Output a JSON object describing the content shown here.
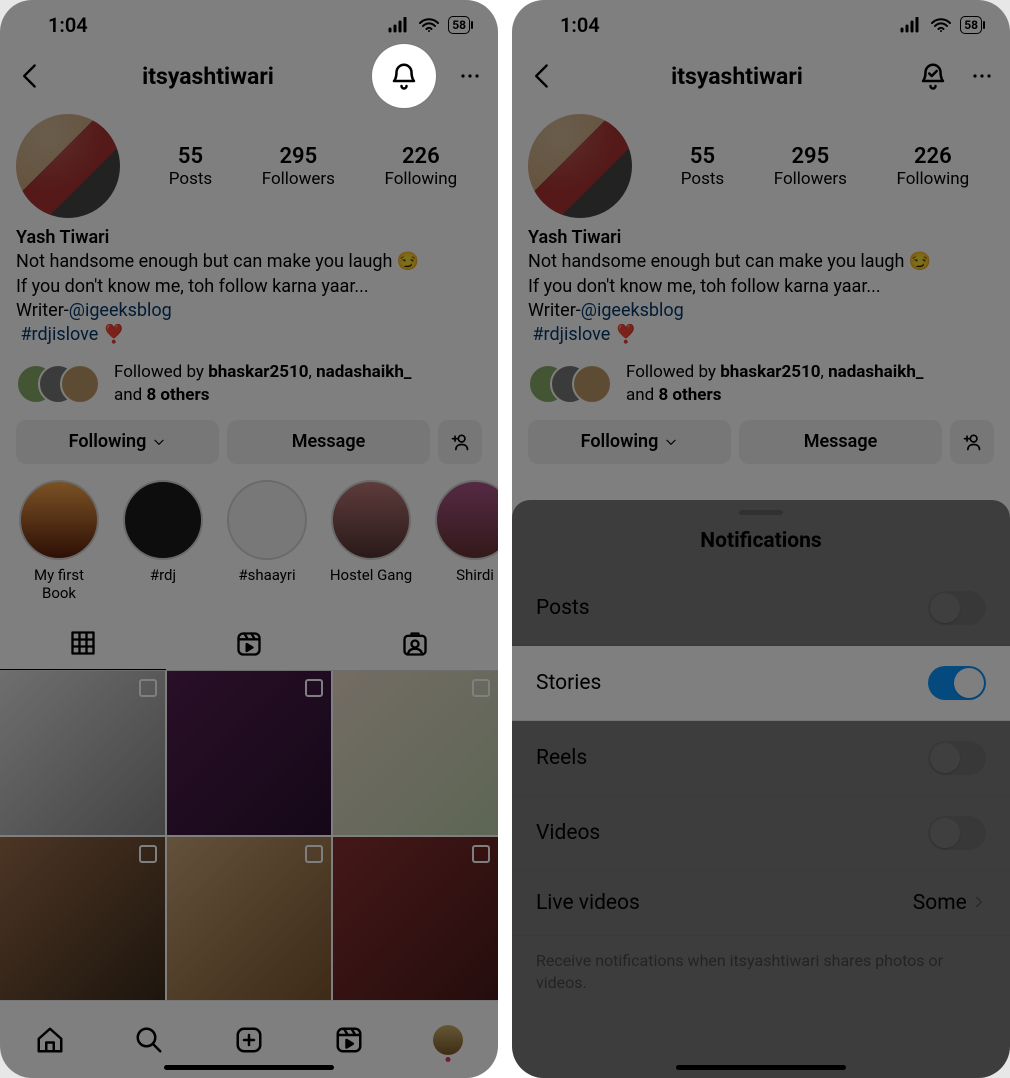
{
  "status": {
    "time": "1:04",
    "battery": "58"
  },
  "header": {
    "username": "itsyashtiwari"
  },
  "profile": {
    "name": "Yash Tiwari",
    "bio_line1": "Not handsome enough but can make you laugh 😏",
    "bio_line2": "If you don't know me, toh follow karna yaar...",
    "bio_writer_prefix": "Writer-",
    "bio_writer_handle": "@igeeksblog",
    "hashtag": "#rdjislove",
    "heart": "❣️",
    "stats": {
      "posts": {
        "num": "55",
        "label": "Posts"
      },
      "followers": {
        "num": "295",
        "label": "Followers"
      },
      "following": {
        "num": "226",
        "label": "Following"
      }
    }
  },
  "followed_by": {
    "prefix": "Followed by ",
    "u1": "bhaskar2510",
    "sep": ", ",
    "u2": "nadashaikh_",
    "suffix1": " and ",
    "count": "8 others"
  },
  "actions": {
    "following": "Following",
    "message": "Message"
  },
  "highlights": [
    {
      "label": "My first Book"
    },
    {
      "label": "#rdj"
    },
    {
      "label": "#shaayri"
    },
    {
      "label": "Hostel Gang"
    },
    {
      "label": "Shirdi"
    }
  ],
  "sheet": {
    "title": "Notifications",
    "rows": {
      "posts": "Posts",
      "stories": "Stories",
      "reels": "Reels",
      "videos": "Videos",
      "live": "Live videos",
      "live_value": "Some"
    },
    "note": "Receive notifications when itsyashtiwari shares photos or videos."
  }
}
